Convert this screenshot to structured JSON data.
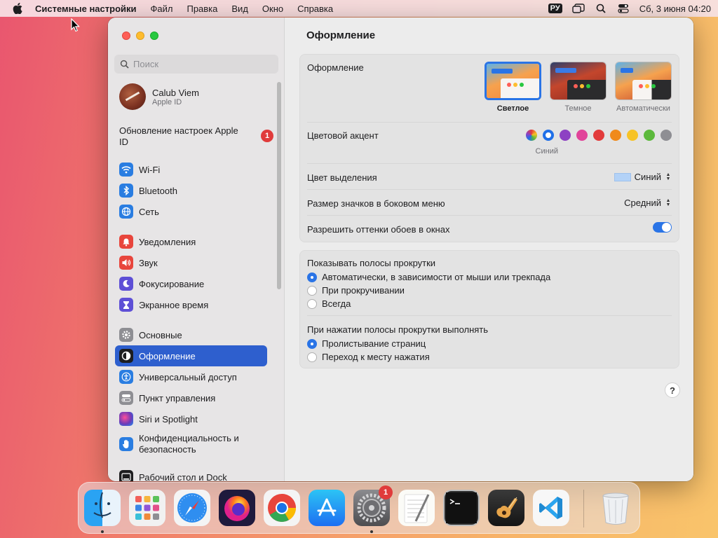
{
  "menubar": {
    "app_name": "Системные настройки",
    "menus": [
      "Файл",
      "Правка",
      "Вид",
      "Окно",
      "Справка"
    ],
    "keyboard_layout": "РУ",
    "datetime": "Сб, 3 июня  04:20"
  },
  "sidebar": {
    "search_placeholder": "Поиск",
    "profile": {
      "name": "Calub Viem",
      "subtitle": "Apple ID"
    },
    "update": {
      "label": "Обновление настроек Apple ID",
      "badge": "1"
    },
    "items": [
      {
        "label": "Wi-Fi",
        "icon": "wifi-icon",
        "color": "#2a7de1"
      },
      {
        "label": "Bluetooth",
        "icon": "bluetooth-icon",
        "color": "#2a7de1"
      },
      {
        "label": "Сеть",
        "icon": "network-globe-icon",
        "color": "#2a7de1"
      },
      {
        "label": "Уведомления",
        "icon": "notifications-bell-icon",
        "color": "#e8453c"
      },
      {
        "label": "Звук",
        "icon": "sound-speaker-icon",
        "color": "#e8453c"
      },
      {
        "label": "Фокусирование",
        "icon": "focus-moon-icon",
        "color": "#5e4fd6"
      },
      {
        "label": "Экранное время",
        "icon": "screen-time-hourglass-icon",
        "color": "#5e4fd6"
      },
      {
        "label": "Основные",
        "icon": "general-gear-icon",
        "color": "#8e8e93"
      },
      {
        "label": "Оформление",
        "icon": "appearance-icon",
        "color": "#1d1d1f"
      },
      {
        "label": "Универсальный доступ",
        "icon": "accessibility-icon",
        "color": "#2a7de1"
      },
      {
        "label": "Пункт управления",
        "icon": "control-center-icon",
        "color": "#8e8e93"
      },
      {
        "label": "Siri и Spotlight",
        "icon": "siri-icon",
        "color": "#6b3bb8"
      },
      {
        "label": "Конфиденциальность и безопасность",
        "icon": "privacy-hand-icon",
        "color": "#2a7de1"
      },
      {
        "label": "Рабочий стол и Dock",
        "icon": "desktop-dock-icon",
        "color": "#1d1d1f"
      }
    ],
    "active_item": "Оформление"
  },
  "main": {
    "title": "Оформление",
    "appearance": {
      "label": "Оформление",
      "options": [
        {
          "caption": "Светлое",
          "selected": true
        },
        {
          "caption": "Темное",
          "selected": false
        },
        {
          "caption": "Автоматически",
          "selected": false
        }
      ]
    },
    "accent": {
      "label": "Цветовой акцент",
      "colors": [
        "multicolor",
        "#1f6fe8",
        "#8d42c3",
        "#e1439a",
        "#e23b3b",
        "#f08a1b",
        "#f7c326",
        "#5cb93c",
        "#8e8e93"
      ],
      "selected_index": 1,
      "selected_caption": "Синий"
    },
    "highlight": {
      "label": "Цвет выделения",
      "value": "Синий",
      "swatch_color": "#b3d2f7"
    },
    "sidebar_icon_size": {
      "label": "Размер значков в боковом меню",
      "value": "Средний"
    },
    "wallpaper_tinting": {
      "label": "Разрешить оттенки обоев в окнах",
      "enabled": true
    },
    "scrollbars": {
      "label": "Показывать полосы прокрутки",
      "options": [
        "Автоматически, в зависимости от мыши или трекпада",
        "При прокручивании",
        "Всегда"
      ],
      "selected_index": 0
    },
    "scroll_click": {
      "label": "При нажатии полосы прокрутки выполнять",
      "options": [
        "Пролистывание страниц",
        "Переход к месту нажатия"
      ],
      "selected_index": 0
    },
    "help_label": "?"
  },
  "dock": {
    "apps": [
      {
        "name": "Finder",
        "icon": "finder-icon",
        "running": true
      },
      {
        "name": "Launchpad",
        "icon": "launchpad-icon",
        "running": false
      },
      {
        "name": "Safari",
        "icon": "safari-icon",
        "running": false
      },
      {
        "name": "Firefox",
        "icon": "firefox-icon",
        "running": false
      },
      {
        "name": "Chrome",
        "icon": "chrome-icon",
        "running": false
      },
      {
        "name": "App Store",
        "icon": "app-store-icon",
        "running": false
      },
      {
        "name": "System Settings",
        "icon": "system-settings-icon",
        "running": true,
        "badge": "1"
      },
      {
        "name": "TextEdit",
        "icon": "textedit-icon",
        "running": false
      },
      {
        "name": "Terminal",
        "icon": "terminal-icon",
        "running": false
      },
      {
        "name": "GarageBand",
        "icon": "garageband-icon",
        "running": false
      },
      {
        "name": "VS Code",
        "icon": "vscode-icon",
        "running": false
      },
      {
        "name": "Trash",
        "icon": "trash-icon",
        "running": false
      }
    ]
  }
}
